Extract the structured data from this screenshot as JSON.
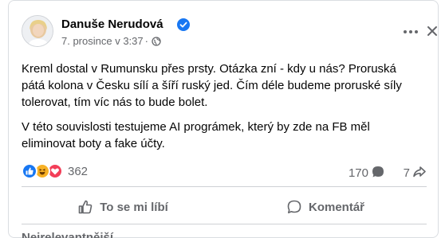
{
  "post": {
    "author": "Danuše Nerudová",
    "timestamp": "7. prosince v 3:37",
    "separator": "·",
    "privacy_icon": "globe-icon",
    "paragraphs": [
      "Kreml dostal v Rumunsku přes prsty. Otázka zní - kdy u nás? Proruská pátá kolona v Česku sílí a šíří ruský jed. Čím déle budeme proruské síly tolerovat, tím víc nás to bude bolet.",
      "V této souvislosti testujeme AI prográmek, který by zde na FB měl eliminovat boty a fake účty."
    ]
  },
  "stats": {
    "reactions": [
      "like",
      "haha",
      "love"
    ],
    "reaction_count": "362",
    "comment_count": "170",
    "share_count": "7"
  },
  "actions": {
    "like_label": "To se mi líbí",
    "comment_label": "Komentář"
  },
  "comments": {
    "sort_label": "Nejrelevantnější"
  },
  "colors": {
    "accent": "#1877f2",
    "secondary_text": "#65676b",
    "haha": "#f7b125",
    "love": "#f33e58"
  }
}
